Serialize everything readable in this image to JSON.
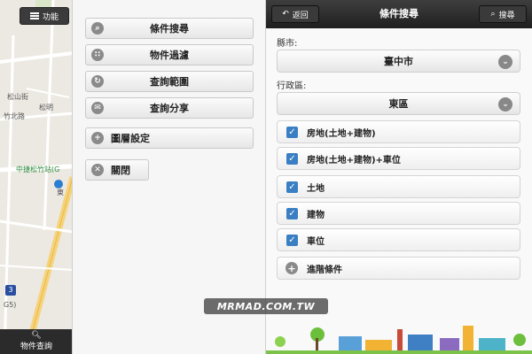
{
  "map": {
    "menu_label": "功能",
    "labels": [
      "松山街",
      "松明",
      "竹北路",
      "中捷松竹站(G",
      "東",
      "G5)"
    ],
    "route_number": "3",
    "bottom_button_label": "物件查詢",
    "search_icon": "search-icon"
  },
  "panel": {
    "items": [
      {
        "label": "條件搜尋",
        "icon": "search-icon"
      },
      {
        "label": "物件過濾",
        "icon": "grid-icon"
      },
      {
        "label": "查詢範圍",
        "icon": "refresh-icon"
      },
      {
        "label": "查詢分享",
        "icon": "mail-icon"
      },
      {
        "label": "圖層設定",
        "icon": "plus-icon"
      }
    ],
    "close_label": "關閉"
  },
  "search": {
    "back_label": "返回",
    "title": "條件搜尋",
    "search_label": "搜尋",
    "county_label": "縣市:",
    "county_value": "臺中市",
    "district_label": "行政區:",
    "district_value": "東區",
    "options": [
      {
        "label": "房地(土地+建物)",
        "checked": true
      },
      {
        "label": "房地(土地+建物)+車位",
        "checked": true
      },
      {
        "label": "土地",
        "checked": true
      },
      {
        "label": "建物",
        "checked": true
      },
      {
        "label": "車位",
        "checked": true
      }
    ],
    "advanced_label": "進階條件"
  },
  "watermark": "MRMAD.COM.TW",
  "colors": {
    "checkbox": "#3a7fc3",
    "header": "#2a2a2a",
    "panel_bg": "#f6f6f6"
  }
}
